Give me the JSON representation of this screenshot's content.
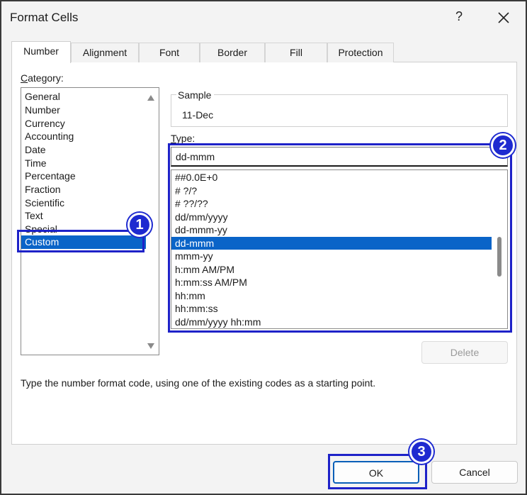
{
  "window": {
    "title": "Format Cells",
    "help": "?",
    "close_icon": "close-icon"
  },
  "tabs": [
    {
      "label": "Number",
      "active": true
    },
    {
      "label": "Alignment"
    },
    {
      "label": "Font"
    },
    {
      "label": "Border"
    },
    {
      "label": "Fill"
    },
    {
      "label": "Protection"
    }
  ],
  "category": {
    "label": "Category:",
    "items": [
      "General",
      "Number",
      "Currency",
      "Accounting",
      "Date",
      "Time",
      "Percentage",
      "Fraction",
      "Scientific",
      "Text",
      "Special",
      "Custom"
    ],
    "selected": "Custom"
  },
  "sample": {
    "label": "Sample",
    "value": "11-Dec"
  },
  "type": {
    "label": "Type:",
    "value": "dd-mmm",
    "items": [
      "##0.0E+0",
      "# ?/?",
      "# ??/??",
      "dd/mm/yyyy",
      "dd-mmm-yy",
      "dd-mmm",
      "mmm-yy",
      "h:mm AM/PM",
      "h:mm:ss AM/PM",
      "hh:mm",
      "hh:mm:ss",
      "dd/mm/yyyy hh:mm"
    ],
    "selected": "dd-mmm"
  },
  "buttons": {
    "delete": "Delete",
    "ok": "OK",
    "cancel": "Cancel"
  },
  "hint": "Type the number format code, using one of the existing codes as a starting point.",
  "badges": [
    "1",
    "2",
    "3"
  ],
  "colors": {
    "selection": "#0a64c8",
    "highlight": "#1e22c8",
    "badge": "#1e2ad0"
  }
}
